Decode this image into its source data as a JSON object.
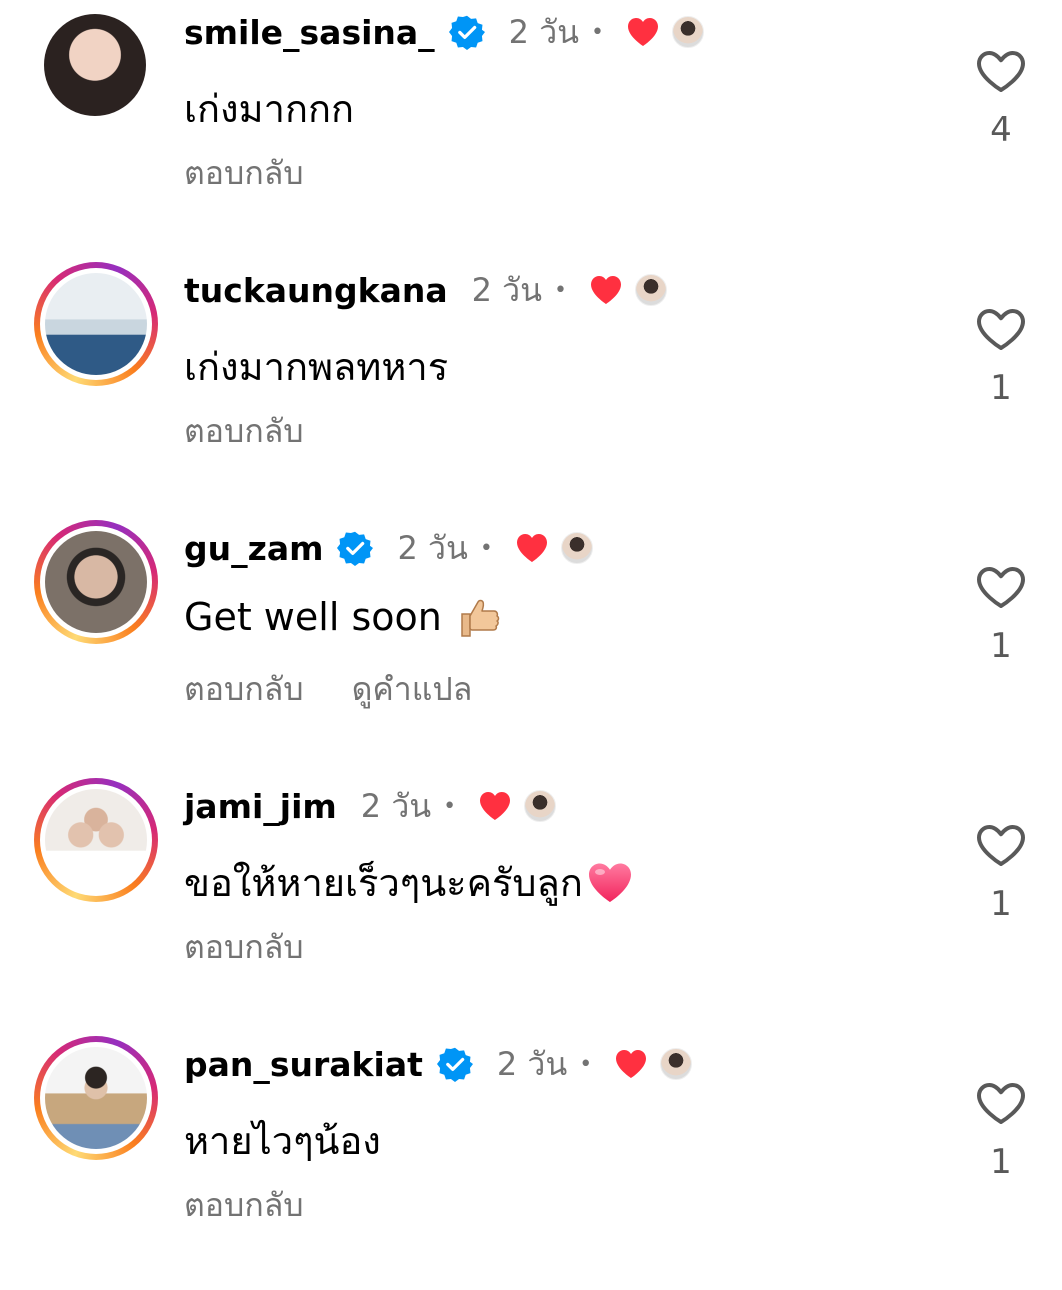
{
  "comments": [
    {
      "username": "smile_sasina_",
      "verified": true,
      "time": "2 วัน",
      "text": "เก่งมากกก",
      "reply_label": "ตอบกลับ",
      "like_count": "4",
      "ring": false,
      "avatar_color": "#c89a86"
    },
    {
      "username": "tuckaungkana",
      "verified": false,
      "time": "2 วัน",
      "text": "เก่งมากพลทหาร",
      "reply_label": "ตอบกลับ",
      "like_count": "1",
      "ring": true,
      "avatar_color": "#9fb3c4"
    },
    {
      "username": "gu_zam",
      "verified": true,
      "time": "2 วัน",
      "text": "Get well soon",
      "emoji": "thumbs-up",
      "reply_label": "ตอบกลับ",
      "translate_label": "ดูคำแปล",
      "like_count": "1",
      "ring": true,
      "avatar_color": "#6d625b"
    },
    {
      "username": "jami_jim",
      "verified": false,
      "time": "2 วัน",
      "text": "ขอให้หายเร็วๆนะครับลูก",
      "emoji": "pink-heart",
      "reply_label": "ตอบกลับ",
      "like_count": "1",
      "ring": true,
      "avatar_color": "#d6cfc9"
    },
    {
      "username": "pan_surakiat",
      "verified": true,
      "time": "2 วัน",
      "text": "หายไวๆน้อง",
      "reply_label": "ตอบกลับ",
      "like_count": "1",
      "ring": true,
      "avatar_color": "#b5a48a"
    }
  ],
  "colors": {
    "verified_blue": "#0095f6",
    "creator_heart_red": "#ff3040",
    "secondary_text": "#737373"
  }
}
